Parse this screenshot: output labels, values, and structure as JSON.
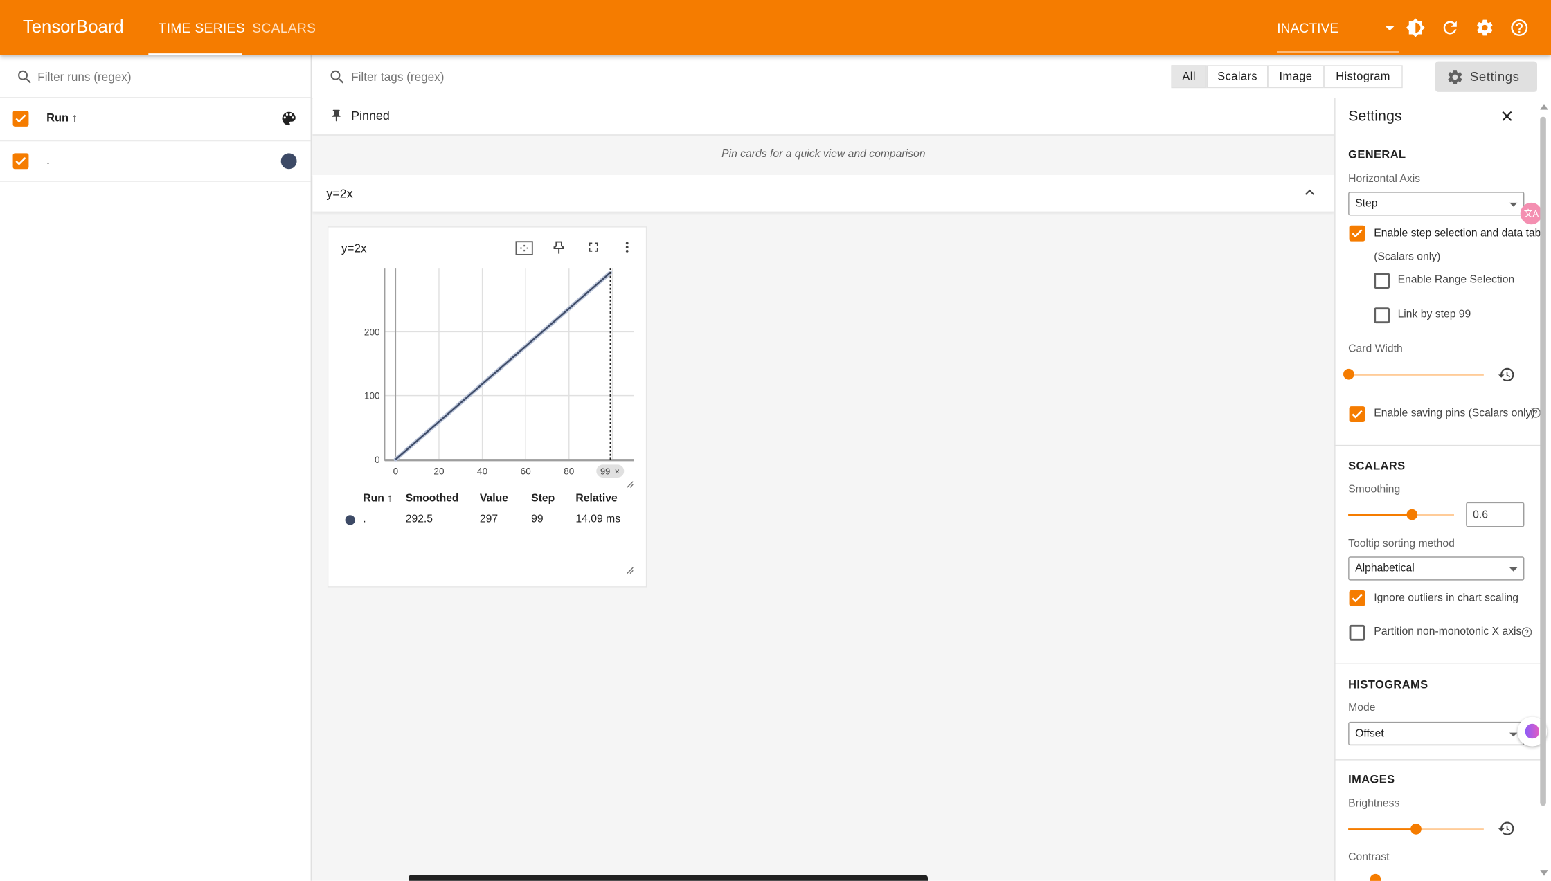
{
  "header": {
    "logo": "TensorBoard",
    "tabs": [
      {
        "label": "TIME SERIES",
        "active": true
      },
      {
        "label": "SCALARS",
        "active": false
      }
    ],
    "status": "INACTIVE",
    "icons": [
      "theme-toggle-icon",
      "refresh-icon",
      "settings-gear-icon",
      "help-icon"
    ]
  },
  "runs_panel": {
    "filter_placeholder": "Filter runs (regex)",
    "header_label": "Run",
    "runs": [
      {
        "name": ".",
        "color": "#3d4a66",
        "checked": true
      }
    ]
  },
  "main": {
    "tag_filter_placeholder": "Filter tags (regex)",
    "type_filters": [
      "All",
      "Scalars",
      "Image",
      "Histogram"
    ],
    "active_type_filter": "All",
    "settings_button": "Settings",
    "pinned": {
      "title": "Pinned",
      "empty_text": "Pin cards for a quick view and comparison"
    },
    "group": {
      "name": "y=2x"
    },
    "card": {
      "title": "y=2x",
      "table": {
        "headers": [
          "Run",
          "Smoothed",
          "Value",
          "Step",
          "Relative"
        ],
        "rows": [
          {
            "run": ".",
            "smoothed": "292.5",
            "value": "297",
            "step": "99",
            "relative": "14.09 ms"
          }
        ]
      }
    }
  },
  "chart_data": {
    "type": "line",
    "title": "y=2x",
    "x": [
      0,
      99
    ],
    "series": [
      {
        "name": ".",
        "color": "#3d4a66",
        "values": [
          0,
          292.5
        ]
      }
    ],
    "xlim": [
      -5,
      110
    ],
    "ylim": [
      -2,
      300
    ],
    "xticks": [
      0,
      20,
      40,
      60,
      80
    ],
    "yticks": [
      0,
      100,
      200
    ],
    "grid": true,
    "step_marker": 99,
    "step_marker_label": "99"
  },
  "settings": {
    "title": "Settings",
    "general": {
      "heading": "GENERAL",
      "horizontal_axis_label": "Horizontal Axis",
      "horizontal_axis_value": "Step",
      "step_selection_label": "Enable step selection and data table",
      "step_selection_sub": "(Scalars only)",
      "range_selection_label": "Enable Range Selection",
      "link_by_step_label": "Link by step 99",
      "card_width_label": "Card Width",
      "card_width_fraction": 0.0,
      "saving_pins_label": "Enable saving pins (Scalars only)"
    },
    "scalars": {
      "heading": "SCALARS",
      "smoothing_label": "Smoothing",
      "smoothing_value": "0.6",
      "smoothing_fraction": 0.6,
      "tooltip_sort_label": "Tooltip sorting method",
      "tooltip_sort_value": "Alphabetical",
      "ignore_outliers_label": "Ignore outliers in chart scaling",
      "partition_label": "Partition non-monotonic X axis"
    },
    "histograms": {
      "heading": "HISTOGRAMS",
      "mode_label": "Mode",
      "mode_value": "Offset"
    },
    "images": {
      "heading": "IMAGES",
      "brightness_label": "Brightness",
      "brightness_fraction": 0.5,
      "contrast_label": "Contrast"
    }
  }
}
